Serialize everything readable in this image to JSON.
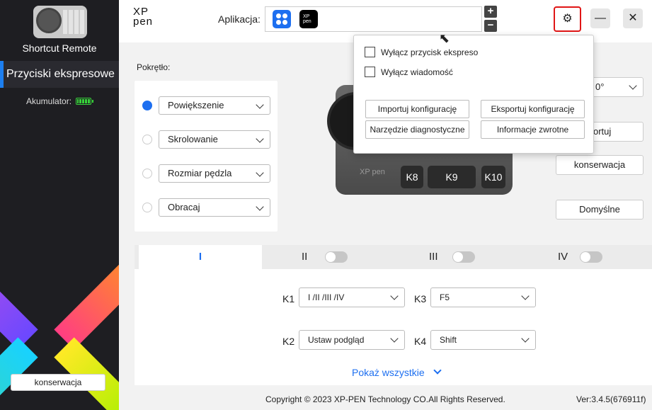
{
  "sidebar": {
    "device_name": "Shortcut Remote",
    "active_item": "Przyciski ekspresowe",
    "battery_label": "Akumulator:",
    "profile_button": "konserwacja"
  },
  "header": {
    "logo": "XP pen",
    "app_label": "Aplikacja:",
    "pen_icon_text": "XP pen",
    "plus": "+",
    "minus": "−",
    "gear": "⚙",
    "minimize": "—",
    "close": "✕"
  },
  "dial": {
    "label": "Pokrętło:",
    "options": [
      "Powiększenie",
      "Skrolowanie",
      "Rozmiar pędzla",
      "Obracaj"
    ],
    "selected_index": 0
  },
  "device": {
    "logo": "XP pen",
    "keys": [
      "K8",
      "K9",
      "K10"
    ]
  },
  "right_panel": {
    "rotation_value": "0°",
    "import_partial": "portuj",
    "profile_button": "konserwacja",
    "default_button": "Domyślne"
  },
  "settings_popup": {
    "checkbox1": "Wyłącz przycisk ekspreso",
    "checkbox2": "Wyłącz wiadomość",
    "import_button": "Importuj konfigurację",
    "export_button": "Eksportuj konfigurację",
    "diagnostic_button": "Narzędzie diagnostyczne",
    "feedback_button": "Informacje zwrotne"
  },
  "tabs": {
    "labels": [
      "I",
      "II",
      "III",
      "IV"
    ],
    "active_index": 0
  },
  "keys": {
    "k1_label": "K1",
    "k1_value": "I /II /III /IV",
    "k2_label": "K2",
    "k2_value": "Ustaw podgląd",
    "k3_label": "K3",
    "k3_value": "F5",
    "k4_label": "K4",
    "k4_value": "Shift"
  },
  "show_all": "Pokaż wszystkie",
  "footer": {
    "copyright": "Copyright © 2023  XP-PEN Technology CO.All Rights Reserved.",
    "version": "Ver:3.4.5(676911f)"
  },
  "colors": {
    "accent": "#1d6ff0",
    "sidebar_bg": "#1e1e22",
    "highlight_red": "#e01616",
    "battery_green": "#37d43a"
  }
}
